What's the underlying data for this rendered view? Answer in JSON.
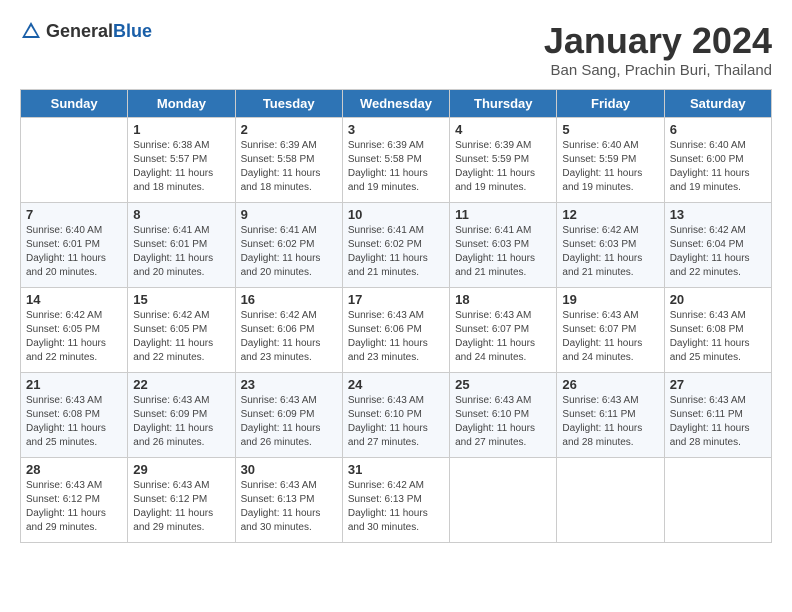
{
  "logo": {
    "general": "General",
    "blue": "Blue"
  },
  "title": {
    "month_year": "January 2024",
    "location": "Ban Sang, Prachin Buri, Thailand"
  },
  "days_of_week": [
    "Sunday",
    "Monday",
    "Tuesday",
    "Wednesday",
    "Thursday",
    "Friday",
    "Saturday"
  ],
  "weeks": [
    [
      {
        "day": "",
        "sunrise": "",
        "sunset": "",
        "daylight": ""
      },
      {
        "day": "1",
        "sunrise": "6:38 AM",
        "sunset": "5:57 PM",
        "daylight": "11 hours and 18 minutes."
      },
      {
        "day": "2",
        "sunrise": "6:39 AM",
        "sunset": "5:58 PM",
        "daylight": "11 hours and 18 minutes."
      },
      {
        "day": "3",
        "sunrise": "6:39 AM",
        "sunset": "5:58 PM",
        "daylight": "11 hours and 19 minutes."
      },
      {
        "day": "4",
        "sunrise": "6:39 AM",
        "sunset": "5:59 PM",
        "daylight": "11 hours and 19 minutes."
      },
      {
        "day": "5",
        "sunrise": "6:40 AM",
        "sunset": "5:59 PM",
        "daylight": "11 hours and 19 minutes."
      },
      {
        "day": "6",
        "sunrise": "6:40 AM",
        "sunset": "6:00 PM",
        "daylight": "11 hours and 19 minutes."
      }
    ],
    [
      {
        "day": "7",
        "sunrise": "6:40 AM",
        "sunset": "6:01 PM",
        "daylight": "11 hours and 20 minutes."
      },
      {
        "day": "8",
        "sunrise": "6:41 AM",
        "sunset": "6:01 PM",
        "daylight": "11 hours and 20 minutes."
      },
      {
        "day": "9",
        "sunrise": "6:41 AM",
        "sunset": "6:02 PM",
        "daylight": "11 hours and 20 minutes."
      },
      {
        "day": "10",
        "sunrise": "6:41 AM",
        "sunset": "6:02 PM",
        "daylight": "11 hours and 21 minutes."
      },
      {
        "day": "11",
        "sunrise": "6:41 AM",
        "sunset": "6:03 PM",
        "daylight": "11 hours and 21 minutes."
      },
      {
        "day": "12",
        "sunrise": "6:42 AM",
        "sunset": "6:03 PM",
        "daylight": "11 hours and 21 minutes."
      },
      {
        "day": "13",
        "sunrise": "6:42 AM",
        "sunset": "6:04 PM",
        "daylight": "11 hours and 22 minutes."
      }
    ],
    [
      {
        "day": "14",
        "sunrise": "6:42 AM",
        "sunset": "6:05 PM",
        "daylight": "11 hours and 22 minutes."
      },
      {
        "day": "15",
        "sunrise": "6:42 AM",
        "sunset": "6:05 PM",
        "daylight": "11 hours and 22 minutes."
      },
      {
        "day": "16",
        "sunrise": "6:42 AM",
        "sunset": "6:06 PM",
        "daylight": "11 hours and 23 minutes."
      },
      {
        "day": "17",
        "sunrise": "6:43 AM",
        "sunset": "6:06 PM",
        "daylight": "11 hours and 23 minutes."
      },
      {
        "day": "18",
        "sunrise": "6:43 AM",
        "sunset": "6:07 PM",
        "daylight": "11 hours and 24 minutes."
      },
      {
        "day": "19",
        "sunrise": "6:43 AM",
        "sunset": "6:07 PM",
        "daylight": "11 hours and 24 minutes."
      },
      {
        "day": "20",
        "sunrise": "6:43 AM",
        "sunset": "6:08 PM",
        "daylight": "11 hours and 25 minutes."
      }
    ],
    [
      {
        "day": "21",
        "sunrise": "6:43 AM",
        "sunset": "6:08 PM",
        "daylight": "11 hours and 25 minutes."
      },
      {
        "day": "22",
        "sunrise": "6:43 AM",
        "sunset": "6:09 PM",
        "daylight": "11 hours and 26 minutes."
      },
      {
        "day": "23",
        "sunrise": "6:43 AM",
        "sunset": "6:09 PM",
        "daylight": "11 hours and 26 minutes."
      },
      {
        "day": "24",
        "sunrise": "6:43 AM",
        "sunset": "6:10 PM",
        "daylight": "11 hours and 27 minutes."
      },
      {
        "day": "25",
        "sunrise": "6:43 AM",
        "sunset": "6:10 PM",
        "daylight": "11 hours and 27 minutes."
      },
      {
        "day": "26",
        "sunrise": "6:43 AM",
        "sunset": "6:11 PM",
        "daylight": "11 hours and 28 minutes."
      },
      {
        "day": "27",
        "sunrise": "6:43 AM",
        "sunset": "6:11 PM",
        "daylight": "11 hours and 28 minutes."
      }
    ],
    [
      {
        "day": "28",
        "sunrise": "6:43 AM",
        "sunset": "6:12 PM",
        "daylight": "11 hours and 29 minutes."
      },
      {
        "day": "29",
        "sunrise": "6:43 AM",
        "sunset": "6:12 PM",
        "daylight": "11 hours and 29 minutes."
      },
      {
        "day": "30",
        "sunrise": "6:43 AM",
        "sunset": "6:13 PM",
        "daylight": "11 hours and 30 minutes."
      },
      {
        "day": "31",
        "sunrise": "6:42 AM",
        "sunset": "6:13 PM",
        "daylight": "11 hours and 30 minutes."
      },
      {
        "day": "",
        "sunrise": "",
        "sunset": "",
        "daylight": ""
      },
      {
        "day": "",
        "sunrise": "",
        "sunset": "",
        "daylight": ""
      },
      {
        "day": "",
        "sunrise": "",
        "sunset": "",
        "daylight": ""
      }
    ]
  ]
}
